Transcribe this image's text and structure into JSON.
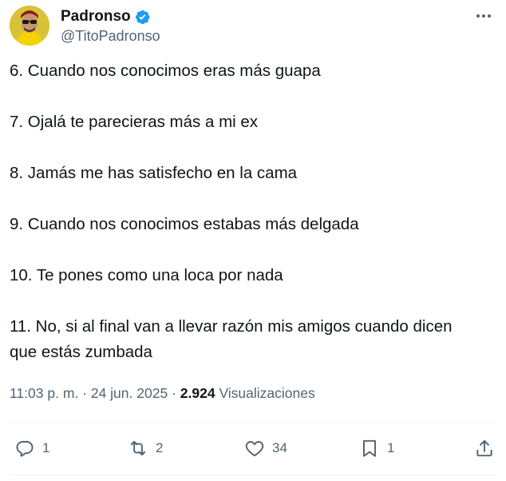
{
  "author": {
    "display_name": "Padronso",
    "handle": "@TitoPadronso",
    "verified": true,
    "avatar_icon": "avatar-yellow-jacket-sunglasses"
  },
  "tweet": {
    "lines": [
      "6. Cuando nos conocimos eras más guapa",
      "7. Ojalá te parecieras más a mi ex",
      "8. Jamás me has satisfecho en la cama",
      "9. Cuando nos conocimos estabas más delgada",
      "10. Te pones como una loca por nada",
      "11. No, si al final van a llevar razón mis amigos cuando dicen",
      "que estás zumbada"
    ]
  },
  "meta": {
    "time": "11:03 p. m.",
    "sep1": "·",
    "date": "24 jun. 2025",
    "sep2": "·",
    "views_count": "2.924",
    "views_label": "Visualizaciones"
  },
  "actions": {
    "reply_count": "1",
    "retweet_count": "2",
    "like_count": "34",
    "bookmark_count": "1"
  },
  "colors": {
    "text": "#0f1419",
    "secondary": "#536471",
    "verified": "#1d9bf0",
    "divider": "#eff3f4"
  }
}
